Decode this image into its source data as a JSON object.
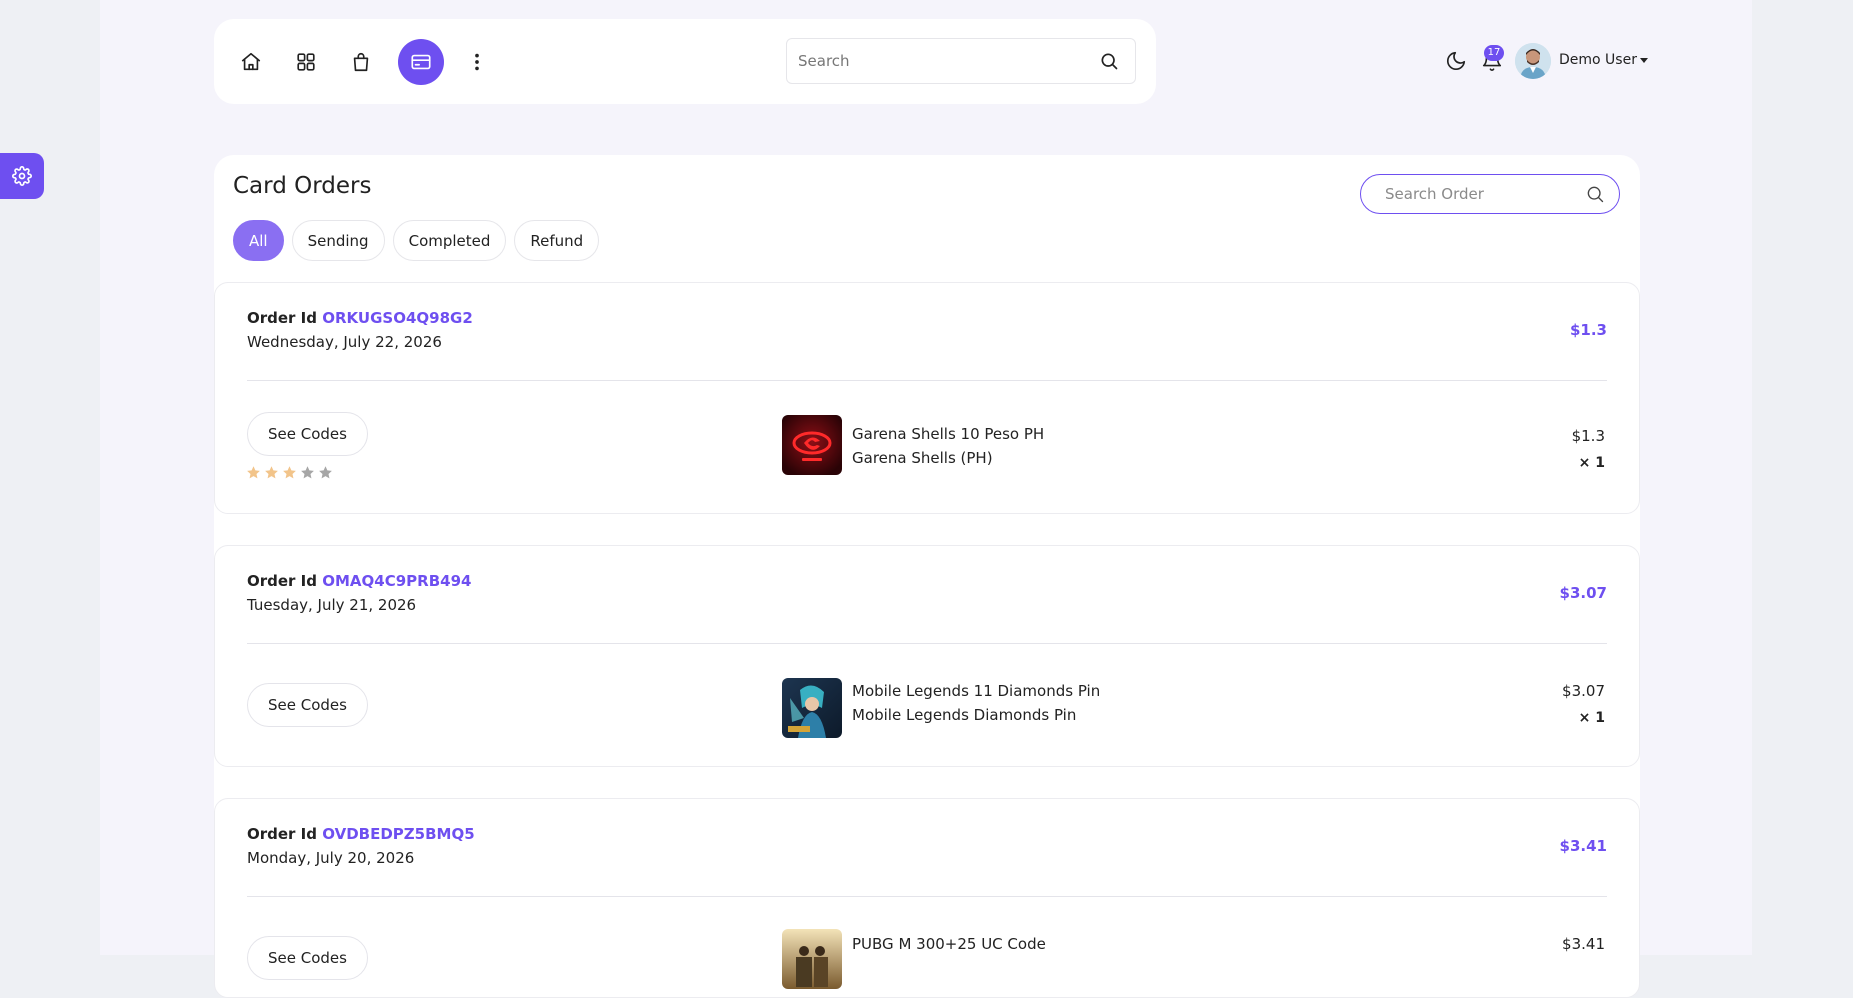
{
  "colors": {
    "accent": "#6e4ff0",
    "accent_light": "#8a6ff2",
    "panel_bg": "#f5f4fb",
    "page_bg": "#eef0f4"
  },
  "nav": {
    "icons": [
      "home-icon",
      "grid-icon",
      "shopping-bag-icon",
      "credit-card-icon",
      "more-vertical-icon"
    ],
    "active": "credit-card-icon"
  },
  "search": {
    "placeholder": "Search"
  },
  "header": {
    "notification_count": "17",
    "user_name": "Demo User"
  },
  "page": {
    "title": "Card Orders",
    "search_placeholder": "Search Order",
    "tabs": [
      {
        "label": "All",
        "active": true
      },
      {
        "label": "Sending",
        "active": false
      },
      {
        "label": "Completed",
        "active": false
      },
      {
        "label": "Refund",
        "active": false
      }
    ]
  },
  "orders": [
    {
      "id_label": "Order Id",
      "id": "ORKUGSO4Q98G2",
      "date": "Wednesday, July 22, 2026",
      "total": "$1.3",
      "see_codes_label": "See Codes",
      "rating": 3,
      "rating_max": 5,
      "product_name": "Garena Shells 10 Peso PH",
      "product_category": "Garena Shells (PH)",
      "item_price": "$1.3",
      "item_qty": "× 1",
      "thumb_icon": "garena-logo-icon"
    },
    {
      "id_label": "Order Id",
      "id": "OMAQ4C9PRB494",
      "date": "Tuesday, July 21, 2026",
      "total": "$3.07",
      "see_codes_label": "See Codes",
      "product_name": "Mobile Legends 11 Diamonds Pin",
      "product_category": "Mobile Legends Diamonds Pin",
      "item_price": "$3.07",
      "item_qty": "× 1",
      "thumb_icon": "mobile-legends-art-icon"
    },
    {
      "id_label": "Order Id",
      "id": "OVDBEDPZ5BMQ5",
      "date": "Monday, July 20, 2026",
      "total": "$3.41",
      "see_codes_label": "See Codes",
      "product_name": "PUBG M 300+25 UC Code",
      "product_category": "",
      "item_price": "$3.41",
      "item_qty": "",
      "thumb_icon": "pubg-art-icon"
    }
  ]
}
